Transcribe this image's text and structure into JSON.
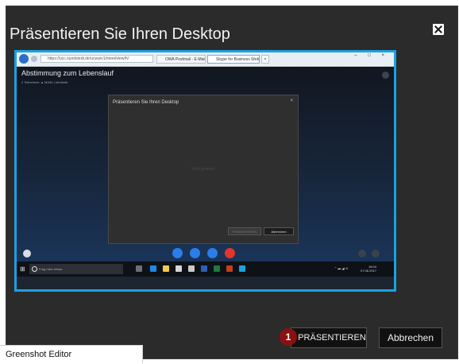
{
  "dialog": {
    "title": "Präsentieren Sie Ihren Desktop",
    "present_button": "PRÄSENTIEREN",
    "cancel_button": "Abbrechen",
    "step_number": "1"
  },
  "preview": {
    "browser": {
      "address": "https://ucc.sundstedt.de/ucwa/v1/meet/view/h/",
      "tabs": [
        "OWA Postmail - E-Mail macht L...",
        "Skype for Business Web App"
      ],
      "add_tab": "×"
    },
    "meeting": {
      "title": "Abstimmung zum Lebenslauf",
      "subtitle": "2 Teilnehmer  ▲  MA36  |  Verbleibt"
    },
    "inner_dialog": {
      "title": "Präsentieren Sie Ihren Desktop",
      "close": "×",
      "placeholder": "Wird geladen",
      "present_button": "PRÄSENTIEREN",
      "cancel_button": "Abbrechen"
    },
    "taskbar": {
      "search_placeholder": "Frag mich etwas",
      "time": "16:04",
      "date": "07.06.2017"
    }
  },
  "footer": {
    "app_label": "Greenshot Editor"
  },
  "colors": {
    "accent_border": "#1ba1e2",
    "dialog_bg": "#2b2b2b",
    "step_badge": "#8b1111"
  },
  "icons": [
    "close-icon",
    "windows-start-icon",
    "search-icon"
  ]
}
